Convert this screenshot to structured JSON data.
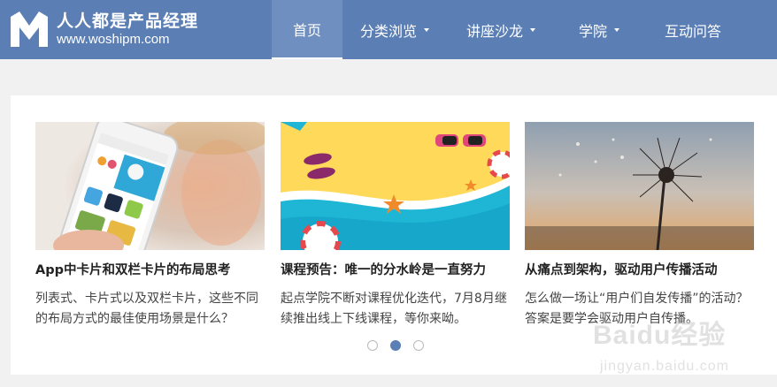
{
  "header": {
    "brand_name": "人人都是产品经理",
    "brand_url": "www.woshipm.com",
    "nav": [
      {
        "label": "首页",
        "active": true
      },
      {
        "label": "分类浏览",
        "dropdown": true
      },
      {
        "label": "讲座沙龙",
        "dropdown": true
      },
      {
        "label": "学院",
        "dropdown": true
      },
      {
        "label": "互动问答"
      }
    ]
  },
  "cards": [
    {
      "image": "phone-app-kids",
      "title": "App中卡片和双栏卡片的布局思考",
      "desc": "列表式、卡片式以及双栏卡片，这些不同的布局方式的最佳使用场景是什么？"
    },
    {
      "image": "beach-illustration",
      "title": "课程预告：唯一的分水岭是一直努力",
      "desc": "起点学院不断对课程优化迭代，7月8月继续推出线上下线课程，等你来呦。"
    },
    {
      "image": "dandelion-sunset",
      "title": "从痛点到架构，驱动用户传播活动",
      "desc": "怎么做一场让“用户们自发传播”的活动？答案是要学会驱动用户自传播。"
    }
  ],
  "carousel": {
    "count": 3,
    "active_index": 1
  },
  "watermark": {
    "main": "Baidu经验",
    "sub": "jingyan.baidu.com"
  },
  "colors": {
    "header": "#5b7fb4",
    "active_nav": "#6e8fbf",
    "background": "#f1f1f1"
  }
}
